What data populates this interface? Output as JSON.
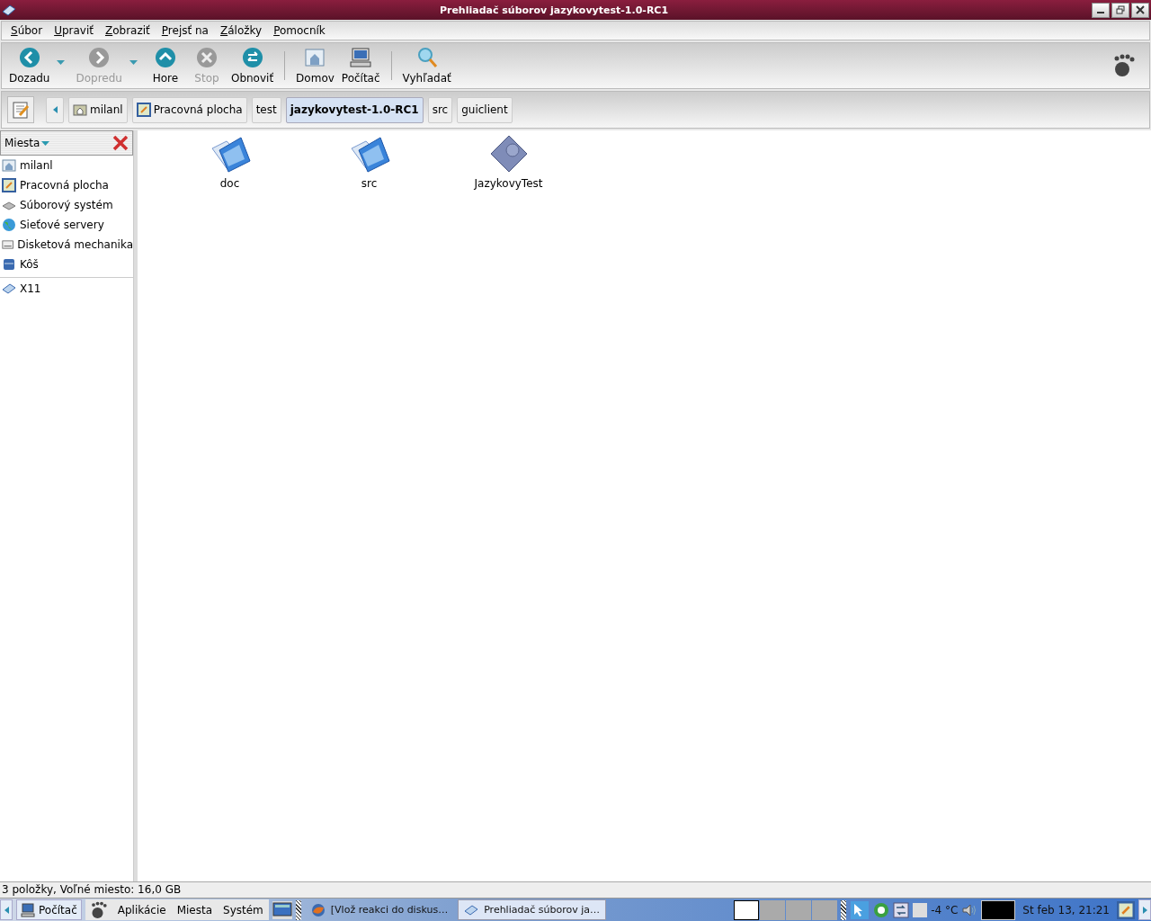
{
  "window": {
    "title": "Prehliadač súborov jazykovytest-1.0-RC1"
  },
  "menu": [
    "Súbor",
    "Upraviť",
    "Zobraziť",
    "Prejsť na",
    "Záložky",
    "Pomocník"
  ],
  "toolbar": [
    {
      "kind": "button",
      "label": "Dozadu",
      "disabled": false,
      "dropdown": true
    },
    {
      "kind": "button",
      "label": "Dopredu",
      "disabled": true,
      "dropdown": true
    },
    {
      "kind": "button",
      "label": "Hore",
      "disabled": false,
      "dropdown": false
    },
    {
      "kind": "button",
      "label": "Stop",
      "disabled": true,
      "dropdown": false
    },
    {
      "kind": "button",
      "label": "Obnoviť",
      "disabled": false,
      "dropdown": false
    },
    {
      "kind": "separator"
    },
    {
      "kind": "button",
      "label": "Domov",
      "disabled": false,
      "dropdown": false
    },
    {
      "kind": "button",
      "label": "Počítač",
      "disabled": false,
      "dropdown": false
    },
    {
      "kind": "separator"
    },
    {
      "kind": "button",
      "label": "Vyhľadať",
      "disabled": false,
      "dropdown": false
    }
  ],
  "location": [
    {
      "label": "milanl",
      "selected": false
    },
    {
      "label": "Pracovná plocha",
      "selected": false
    },
    {
      "label": "test",
      "selected": false
    },
    {
      "label": "jazykovytest-1.0-RC1",
      "selected": true
    },
    {
      "label": "src",
      "selected": false
    },
    {
      "label": "guiclient",
      "selected": false
    }
  ],
  "sidebar": {
    "title": "Miesta",
    "groups": [
      [
        {
          "label": "milanl"
        },
        {
          "label": "Pracovná plocha"
        },
        {
          "label": "Súborový systém"
        },
        {
          "label": "Sieťové servery"
        },
        {
          "label": "Disketová mechanika"
        },
        {
          "label": "Kôš"
        }
      ],
      [
        {
          "label": "X11"
        }
      ]
    ]
  },
  "files": [
    {
      "name": "doc",
      "kind": "folder"
    },
    {
      "name": "src",
      "kind": "folder"
    },
    {
      "name": "JazykovyTest",
      "kind": "executable"
    }
  ],
  "status_bar": "3 položky, Voľné miesto: 16,0 GB",
  "taskbar": {
    "computer": "Počítač",
    "menus": [
      "Aplikácie",
      "Miesta",
      "Systém"
    ],
    "tasks": [
      {
        "label": "[Vlož reakci do diskus…",
        "selected": false
      },
      {
        "label": "Prehliadač súborov ja…",
        "selected": true
      }
    ],
    "workspaces": [
      {
        "selected": true
      },
      {
        "selected": false
      },
      {
        "selected": false
      },
      {
        "selected": false
      }
    ],
    "temperature": "-4 °C",
    "clock": "St feb 13, 21:21"
  }
}
